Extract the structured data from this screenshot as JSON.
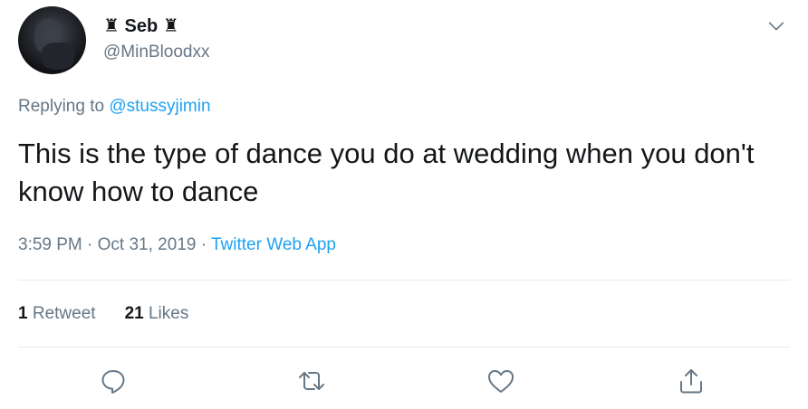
{
  "user": {
    "display_name": "♜ Seb ♜",
    "username": "@MinBloodxx"
  },
  "reply": {
    "prefix": "Replying to",
    "handle": "@stussyjimin"
  },
  "tweet": {
    "text": "This is the type of dance you do at wedding when you don't know how to dance",
    "time": "3:59 PM",
    "date": "Oct 31, 2019",
    "source": "Twitter Web App"
  },
  "stats": {
    "retweets_count": "1",
    "retweets_label": "Retweet",
    "likes_count": "21",
    "likes_label": "Likes"
  },
  "icons": {
    "caret": "chevron-down-icon",
    "reply": "reply-icon",
    "retweet": "retweet-icon",
    "like": "heart-icon",
    "share": "share-icon"
  },
  "colors": {
    "text": "#14171a",
    "muted": "#657786",
    "accent": "#1da1f2",
    "divider": "#e6ecf0"
  }
}
